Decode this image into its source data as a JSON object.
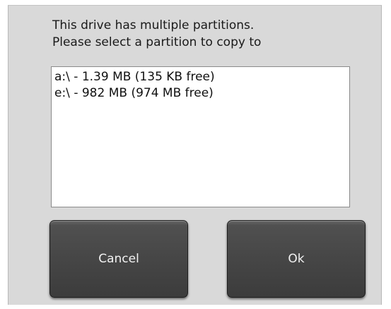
{
  "dialog": {
    "message_line1": "This drive has multiple partitions.",
    "message_line2": "Please select a partition to copy to",
    "partitions": [
      "a:\\ - 1.39 MB (135 KB free)",
      "e:\\ - 982 MB (974 MB free)"
    ],
    "cancel_label": "Cancel",
    "ok_label": "Ok"
  }
}
